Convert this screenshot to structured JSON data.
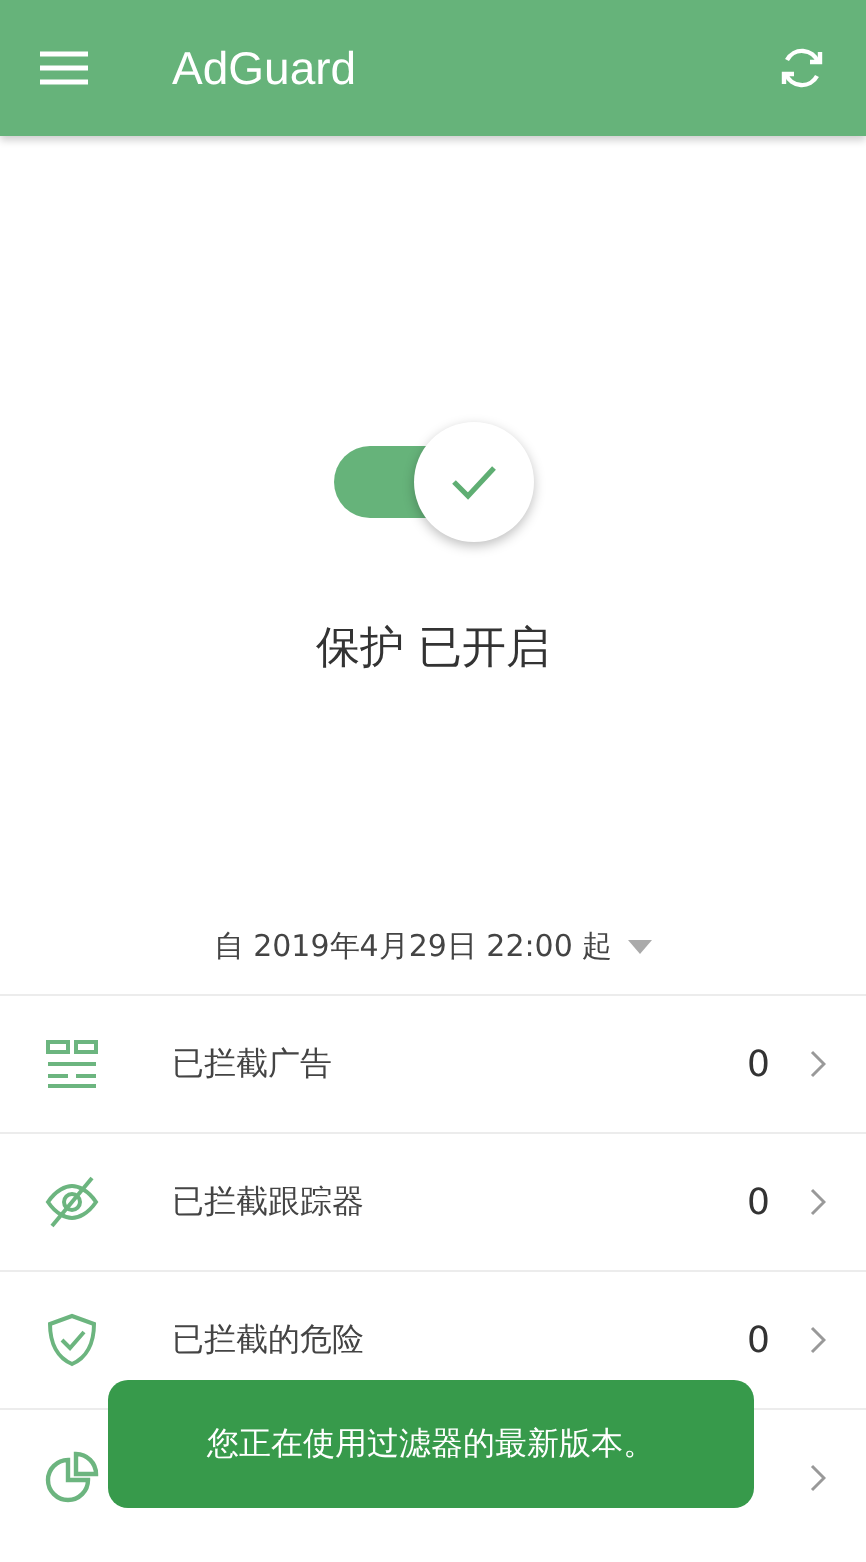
{
  "app_bar": {
    "title": "AdGuard"
  },
  "protection": {
    "on": true,
    "status": "保护 已开启"
  },
  "since": {
    "label": "自 2019年4月29日 22:00 起"
  },
  "stats": [
    {
      "kind": "stat",
      "label": "已拦截广告",
      "value": "0"
    },
    {
      "kind": "stat",
      "label": "已拦截跟踪器",
      "value": "0"
    },
    {
      "kind": "stat",
      "label": "已拦截的危险",
      "value": "0"
    },
    {
      "kind": "covered"
    }
  ],
  "toast": {
    "message": "您正在使用过滤器的最新版本。"
  }
}
